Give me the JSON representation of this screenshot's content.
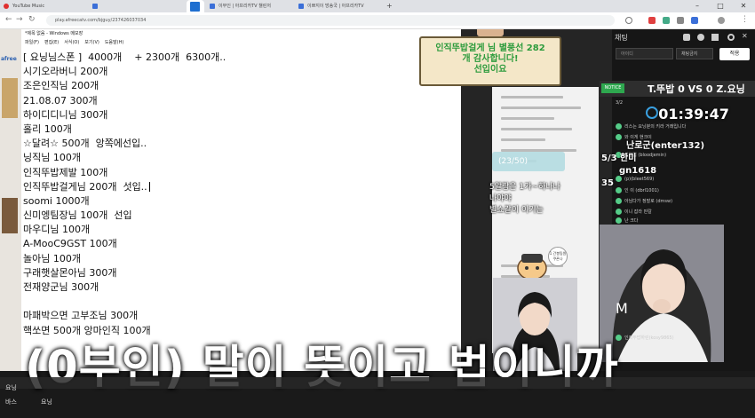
{
  "browser": {
    "tabs": [
      {
        "label": "YouTube Music",
        "active": false,
        "fav_color": "#e03030"
      },
      {
        "label": "",
        "active": false,
        "fav_color": "#3b6fd8"
      },
      {
        "label": "",
        "active": true,
        "fav_color": "#1f6fd0"
      },
      {
        "label": "이부인 | 아프리카TV 챌린저",
        "active": false,
        "fav_color": "#3b6fd8"
      },
      {
        "label": "이쁘지이 방송국 | 아프리카TV",
        "active": false,
        "fav_color": "#3b6fd8"
      }
    ],
    "new_tab_label": "+",
    "window_controls": {
      "minimize": "–",
      "maximize": "□",
      "close": "✕"
    },
    "url": "play.afreecatv.com/bjguy/237426037034",
    "accent": "#1f6fd0"
  },
  "notepad": {
    "title": "*제목 없음 - Windows 메모장",
    "menu": [
      "파일(F)",
      "편집(E)",
      "서식(O)",
      "보기(V)",
      "도움말(H)"
    ],
    "lines": [
      "[ 요닝님스폰 ]  4000개    + 2300개  6300개..",
      "시기오라버니 200개",
      "조은인직님 200개",
      "21.08.07 300개",
      "하이디디니님 300개",
      "홀리 100개",
      "☆달려☆ 500개  앙쪽에선입..",
      "닝직님 100개",
      "인직뚜밥제발 100개",
      "인직뚜밥걸게님 200개  섯입..",
      "soomi 1000개",
      "신미엥팀장님 100개  선입",
      "마우디님 100개",
      "A-MooC9GST 100개",
      "놀아님 100개",
      "구래햇살몬아님 300개",
      "전재양군님 300개",
      "",
      "마패박으면 고부조님 300개",
      "핵쏘면 500개 앙마인직 100개"
    ]
  },
  "left_logo": "afree",
  "banner": {
    "lines": [
      "인직뚜밥걸게 님 별풍선 282",
      "개 감사합니다!",
      "선입이요"
    ],
    "text_color": "#2c9b3c"
  },
  "middle": {
    "progress_label": "(23/50)",
    "overlay_lines": [
      "5알람은 1가~하나나",
      "나야야",
      "별쇼같이 이기는"
    ],
    "sticker_text": "1 간봉팀원 쿠폰나"
  },
  "chat": {
    "title": "채팅",
    "input_placeholder": "아이디",
    "select_value": "채팅금지",
    "apply_label": "적용",
    "notice_tag": "NOTICE",
    "vs_text": "T.뚜밥 0 VS 0 Z.요닝",
    "timer": "01:39:47",
    "timer_prefix": "3/2",
    "rows": [
      "리스는 요닝분의 키라 거래입니다",
      "와 이게 현크이",
      "정열입 (bloodjemin)",
      "(p)(bleet569)",
      "인 이 (dbrl1001)",
      "아님다가 정말로 (dmsw)",
      "이니 잡라 딴칼",
      "난 크다",
      "인직뚜밥하린(kosy9865)"
    ],
    "big_nicks": [
      "난로군(enter132)",
      "gn1618",
      "5/3 한미",
      "35"
    ],
    "accent": "#2ea84f"
  },
  "subtitle": "(0부인) 말이 뜻이고 법이니까",
  "taskbar": {
    "items": [
      "요닝",
      "바스",
      "요닝"
    ]
  }
}
